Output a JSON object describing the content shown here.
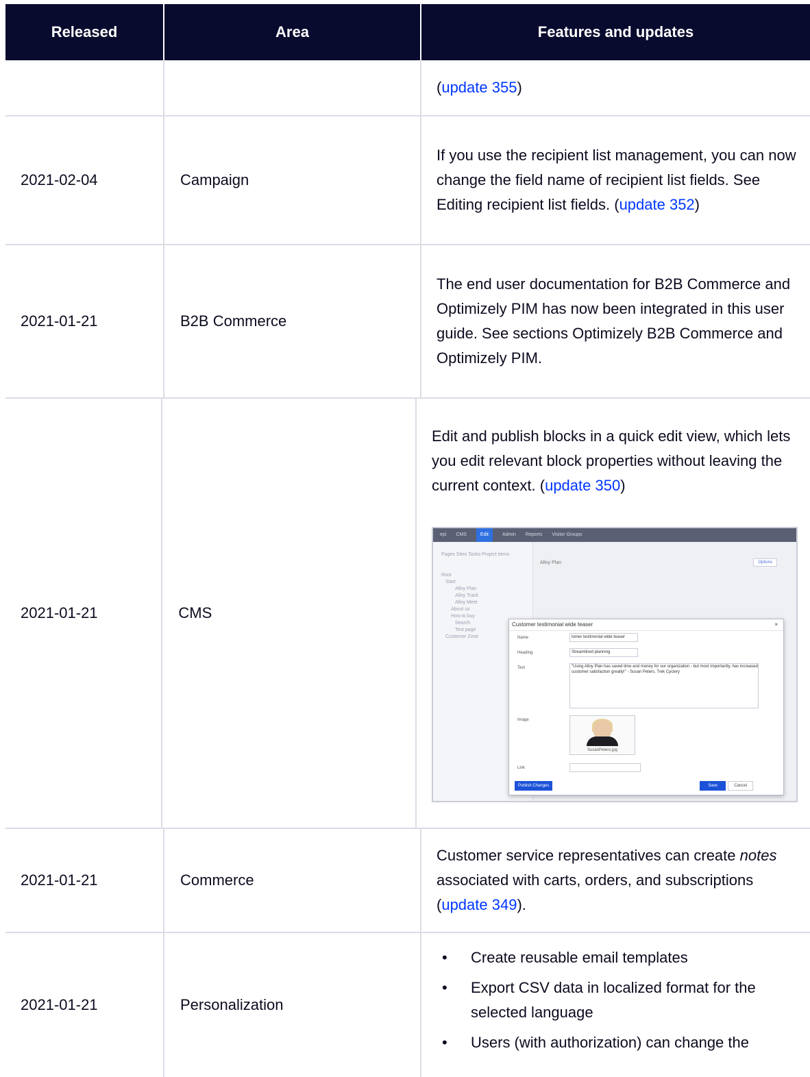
{
  "table": {
    "headers": [
      "Released",
      "Area",
      "Features and updates"
    ],
    "row0": {
      "released": "",
      "area": "",
      "text_open": "(",
      "link": "update 355",
      "text_close": ")"
    },
    "row1": {
      "released": "2021-02-04",
      "area": "Campaign",
      "text": "If you use the recipient list management, you can now change the field name of recipient list fields. See Editing recipient list fields. (",
      "link": "update 352",
      "text_close": ")"
    },
    "row2": {
      "released": "2021-01-21",
      "area": "B2B Commerce",
      "text": "The end user documentation for B2B Commerce and Optimizely PIM has now been integrated in this user guide. See sections Optimizely B2B Commerce and Optimizely PIM."
    },
    "row3": {
      "released": "2021-01-21",
      "area": "CMS",
      "text": "Edit and publish blocks in a quick edit view, which lets you edit relevant block properties without leaving the current context. (",
      "link": "update 350",
      "text_close": ")"
    },
    "row4": {
      "released": "2021-01-21",
      "area": "Commerce",
      "text_before": "Customer service representatives can create ",
      "italic": "notes",
      "text_after": " associated with carts, orders, and subscriptions (",
      "link": "update 349",
      "text_close": ")."
    },
    "row5": {
      "released": "2021-01-21",
      "area": "Personalization",
      "bullets": [
        "Create reusable email templates",
        "Export CSV data in localized format for the selected language",
        "Users (with authorization) can change the"
      ]
    }
  },
  "screenshot": {
    "topbar": [
      "epi",
      "CMS",
      "Edit",
      "Admin",
      "Reports",
      "Visitor Groups"
    ],
    "tree": [
      "Pages  Sites  Tasks  Project items",
      "Root",
      "Start",
      "Alloy Plan",
      "Alloy Track",
      "Alloy Meet",
      "About us",
      "How to buy",
      "Search",
      "Test page",
      "Customer Zone"
    ],
    "page_title": "Alloy Plan",
    "dialog_title": "Customer testimonial wide teaser",
    "fields": {
      "name_label": "Name",
      "name_value": "tomer testimonial wide teaser",
      "heading_label": "Heading",
      "heading_value": "Streamlined planning",
      "text_label": "Text",
      "text_value": "\"Using Alloy Plan has saved time and money for our organization - but most importantly, has increased customer satisfaction greatly!\" - Susan Peters, Trek Cyclery",
      "image_label": "Image",
      "image_file": "SusanPeters.jpg",
      "link_label": "Link"
    },
    "buttons": {
      "publish": "Publish Changes",
      "save": "Save",
      "cancel": "Cancel",
      "options": "Options",
      "close": "×"
    }
  },
  "colors": {
    "header_bg": "#080a2e",
    "link": "#0037ff",
    "border": "#dcdce6"
  }
}
